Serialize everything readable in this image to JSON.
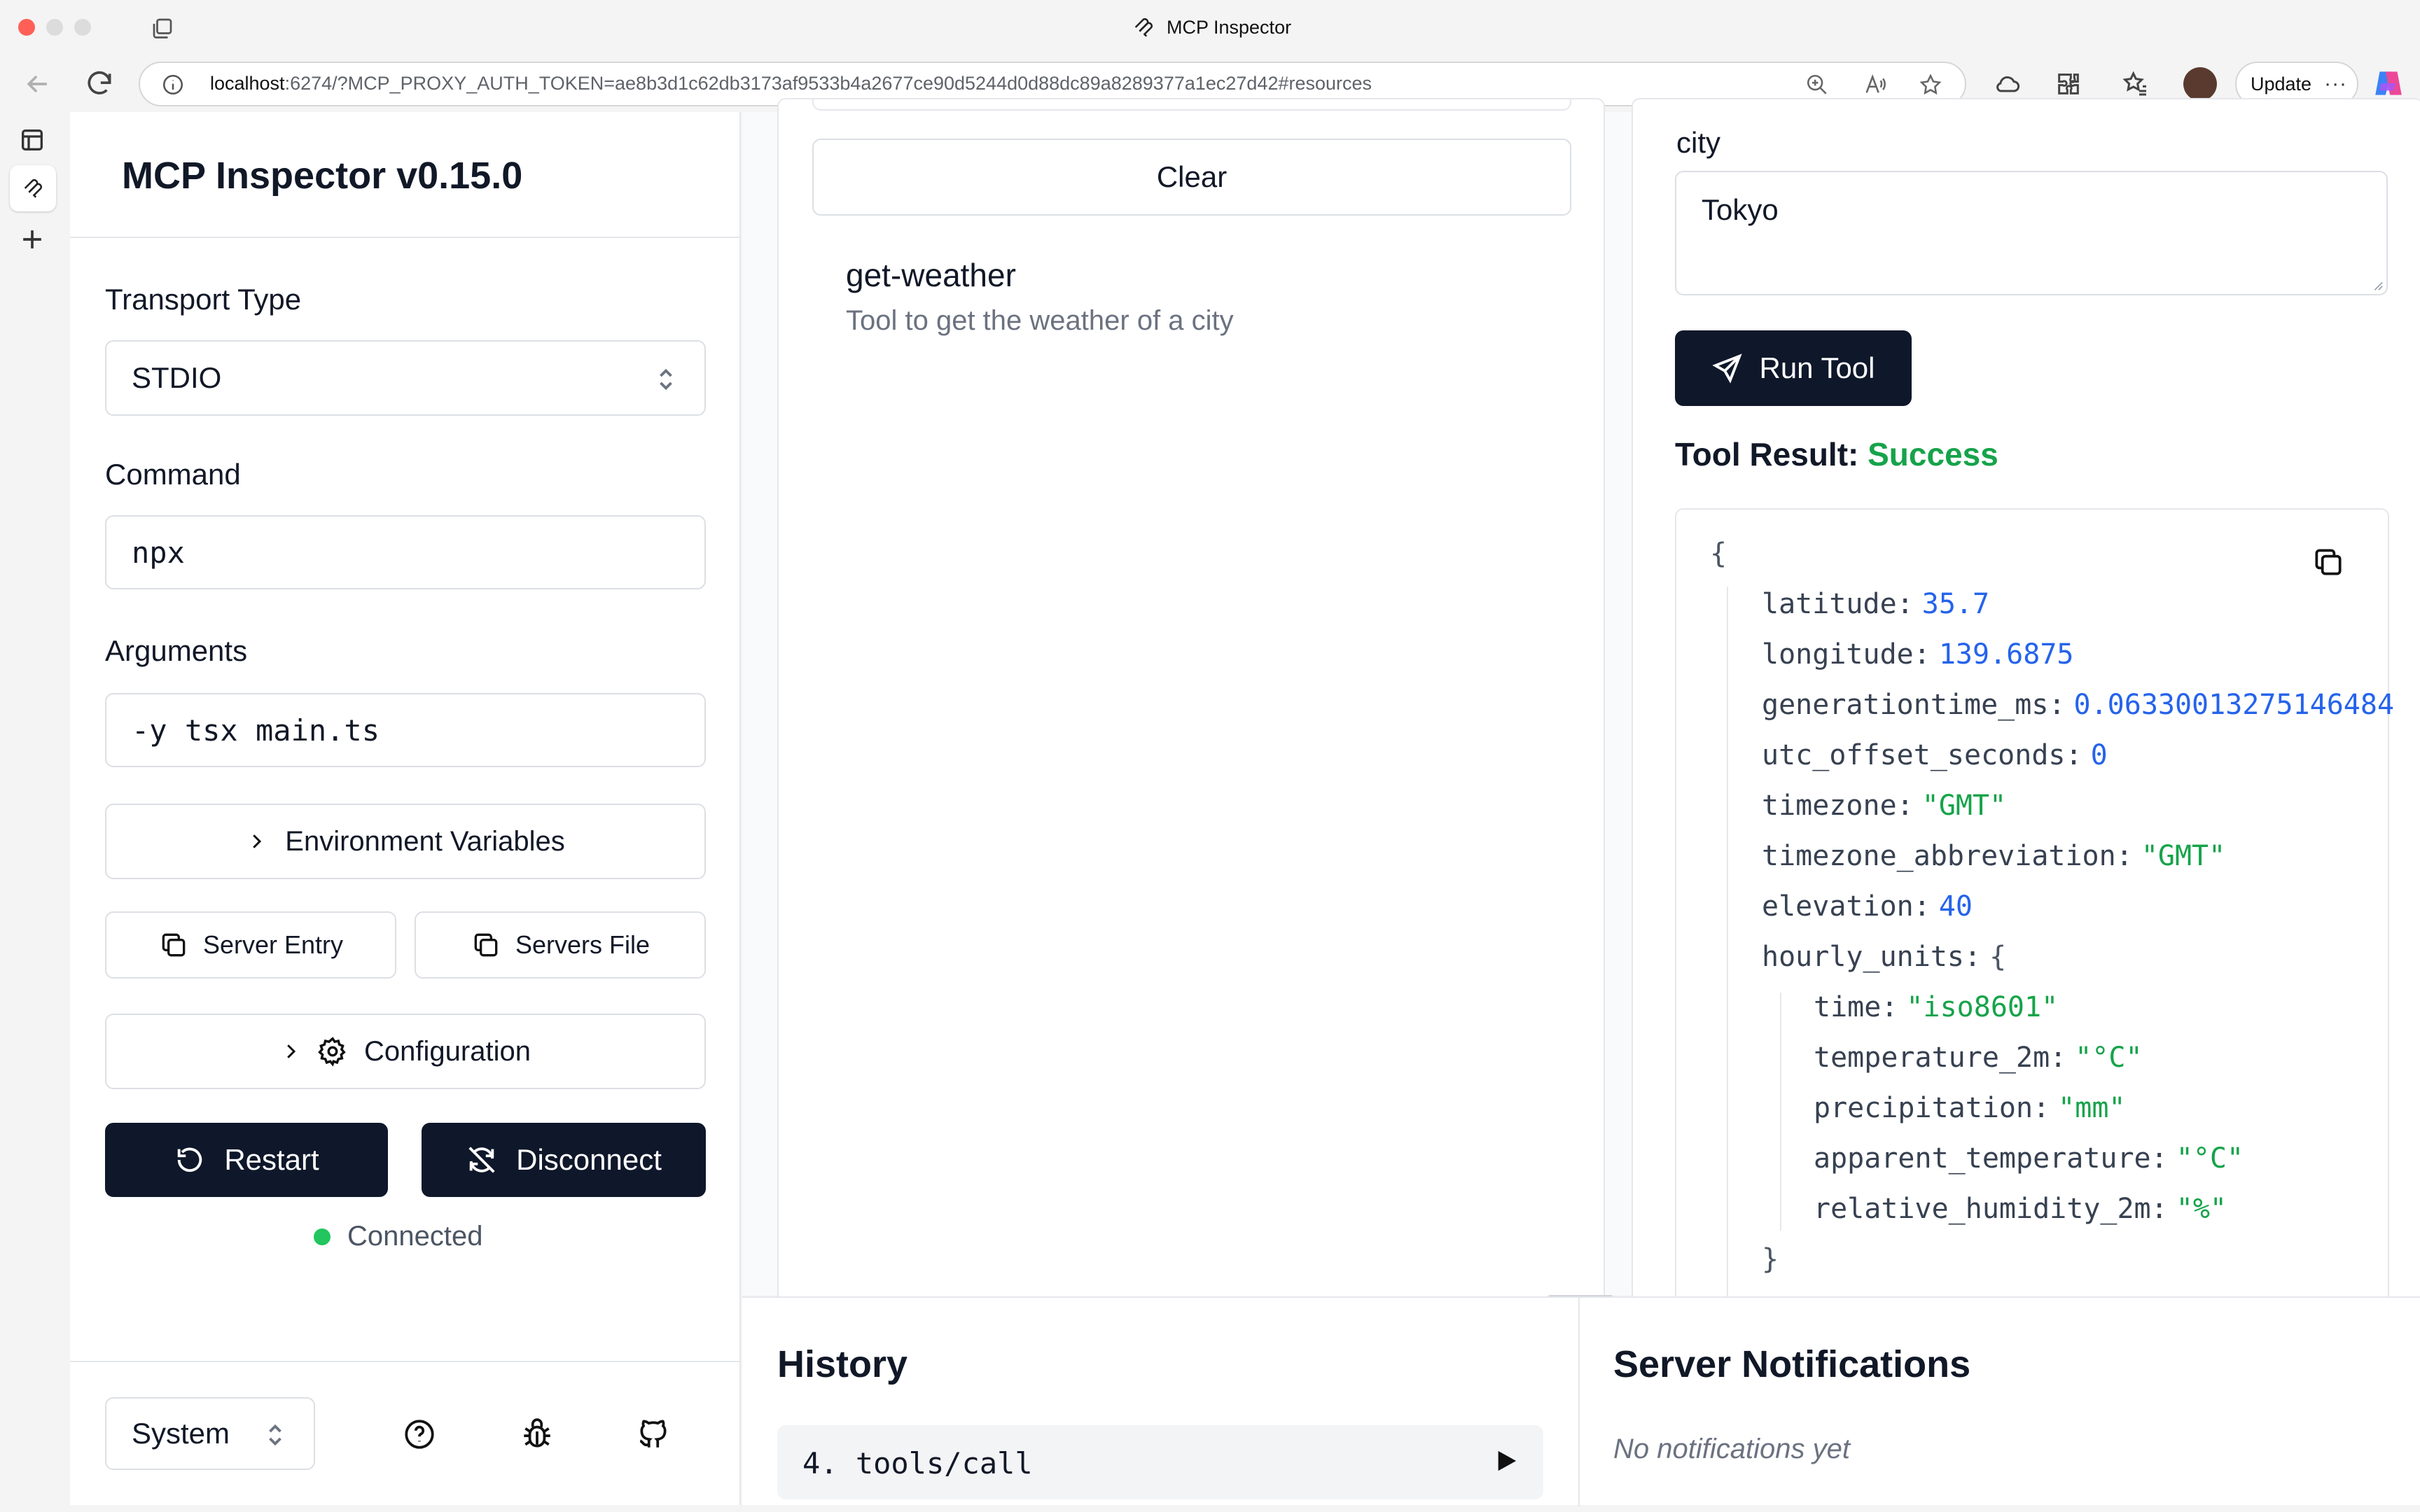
{
  "browser": {
    "tab_title": "MCP Inspector",
    "url_host": "localhost",
    "url_rest": ":6274/?MCP_PROXY_AUTH_TOKEN=ae8b3d1c62db3173af9533b4a2677ce90d5244d0d88dc89a8289377a1ec27d42#resources",
    "update_label": "Update"
  },
  "sidebar": {
    "app_title": "MCP Inspector v0.15.0",
    "transport_label": "Transport Type",
    "transport_value": "STDIO",
    "command_label": "Command",
    "command_value": "npx",
    "arguments_label": "Arguments",
    "arguments_value": "-y tsx main.ts",
    "env_label": "Environment Variables",
    "server_entry_label": "Server Entry",
    "servers_file_label": "Servers File",
    "configuration_label": "Configuration",
    "restart_label": "Restart",
    "disconnect_label": "Disconnect",
    "status_text": "Connected",
    "theme_value": "System"
  },
  "tools": {
    "clear_label": "Clear",
    "items": [
      {
        "name": "get-weather",
        "description": "Tool to get the weather of a city"
      }
    ]
  },
  "tool_detail": {
    "param_label": "city",
    "param_value": "Tokyo",
    "run_label": "Run Tool",
    "result_label": "Tool Result:",
    "result_status": "Success",
    "json_lines": [
      {
        "indent": 0,
        "tokens": [
          {
            "t": "{",
            "c": "jpunc"
          }
        ]
      },
      {
        "indent": 1,
        "tokens": [
          {
            "t": "latitude:",
            "c": "jkey"
          },
          {
            "t": "35.7",
            "c": "jnum"
          }
        ]
      },
      {
        "indent": 1,
        "tokens": [
          {
            "t": "longitude:",
            "c": "jkey"
          },
          {
            "t": "139.6875",
            "c": "jnum"
          }
        ]
      },
      {
        "indent": 1,
        "tokens": [
          {
            "t": "generationtime_ms:",
            "c": "jkey"
          },
          {
            "t": "0.06330013275146484",
            "c": "jnum"
          }
        ]
      },
      {
        "indent": 1,
        "tokens": [
          {
            "t": "utc_offset_seconds:",
            "c": "jkey"
          },
          {
            "t": "0",
            "c": "jnum"
          }
        ]
      },
      {
        "indent": 1,
        "tokens": [
          {
            "t": "timezone:",
            "c": "jkey"
          },
          {
            "t": "\"GMT\"",
            "c": "jstr"
          }
        ]
      },
      {
        "indent": 1,
        "tokens": [
          {
            "t": "timezone_abbreviation:",
            "c": "jkey"
          },
          {
            "t": "\"GMT\"",
            "c": "jstr"
          }
        ]
      },
      {
        "indent": 1,
        "tokens": [
          {
            "t": "elevation:",
            "c": "jkey"
          },
          {
            "t": "40",
            "c": "jnum"
          }
        ]
      },
      {
        "indent": 1,
        "tokens": [
          {
            "t": "hourly_units:",
            "c": "jkey"
          },
          {
            "t": "{",
            "c": "jpunc"
          }
        ]
      },
      {
        "indent": 2,
        "tokens": [
          {
            "t": "time:",
            "c": "jkey"
          },
          {
            "t": "\"iso8601\"",
            "c": "jstr"
          }
        ]
      },
      {
        "indent": 2,
        "tokens": [
          {
            "t": "temperature_2m:",
            "c": "jkey"
          },
          {
            "t": "\"°C\"",
            "c": "jstr"
          }
        ]
      },
      {
        "indent": 2,
        "tokens": [
          {
            "t": "precipitation:",
            "c": "jkey"
          },
          {
            "t": "\"mm\"",
            "c": "jstr"
          }
        ]
      },
      {
        "indent": 2,
        "tokens": [
          {
            "t": "apparent_temperature:",
            "c": "jkey"
          },
          {
            "t": "\"°C\"",
            "c": "jstr"
          }
        ]
      },
      {
        "indent": 2,
        "tokens": [
          {
            "t": "relative_humidity_2m:",
            "c": "jkey"
          },
          {
            "t": "\"%\"",
            "c": "jstr"
          }
        ]
      },
      {
        "indent": 1,
        "tokens": [
          {
            "t": "}",
            "c": "jpunc"
          }
        ]
      }
    ]
  },
  "history": {
    "title": "History",
    "items": [
      {
        "label": "4. tools/call"
      }
    ]
  },
  "notifications": {
    "title": "Server Notifications",
    "empty_text": "No notifications yet"
  },
  "colors": {
    "success": "#16a34a",
    "connected": "#22c55e",
    "dark_button": "#0f172a",
    "json_number": "#2563eb",
    "json_string": "#16a34a"
  }
}
